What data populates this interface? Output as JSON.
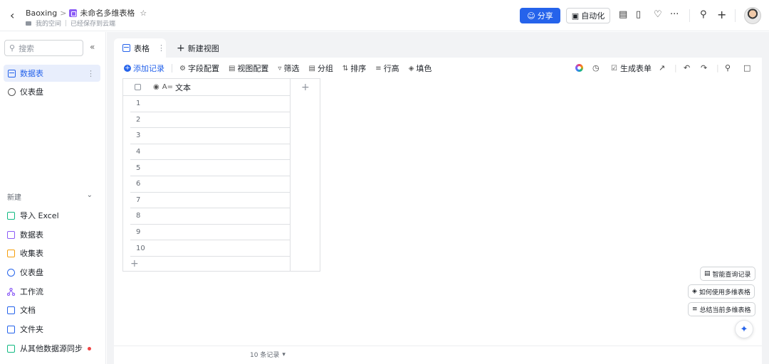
{
  "header": {
    "breadcrumb_root": "Baoxing",
    "breadcrumb_sep": ">",
    "doc_title": "未命名多维表格",
    "location": "我的空间",
    "save_status": "已经保存到云端",
    "share_label": "分享",
    "automation_label": "自动化"
  },
  "sidebar": {
    "search_placeholder": "搜索",
    "items": [
      {
        "label": "数据表",
        "active": true
      },
      {
        "label": "仪表盘",
        "active": false
      }
    ],
    "new_section": "新建",
    "new_items": [
      {
        "label": "导入 Excel",
        "icon": "excel-icon"
      },
      {
        "label": "数据表",
        "icon": "table-icon"
      },
      {
        "label": "收集表",
        "icon": "form-icon"
      },
      {
        "label": "仪表盘",
        "icon": "dashboard-icon"
      },
      {
        "label": "工作流",
        "icon": "workflow-icon"
      },
      {
        "label": "文档",
        "icon": "document-icon"
      },
      {
        "label": "文件夹",
        "icon": "folder-icon"
      },
      {
        "label": "从其他数据源同步",
        "icon": "sync-icon"
      }
    ]
  },
  "tabs": {
    "active_label": "表格",
    "new_view_label": "新建视图"
  },
  "toolbar": {
    "add_record": "添加记录",
    "field_config": "字段配置",
    "view_config": "视图配置",
    "filter": "筛选",
    "group": "分组",
    "sort": "排序",
    "row_height": "行高",
    "fill_color": "填色",
    "generate_form": "生成表单"
  },
  "grid": {
    "field_type": "A=",
    "field_name": "文本",
    "rows": [
      "1",
      "2",
      "3",
      "4",
      "5",
      "6",
      "7",
      "8",
      "9",
      "10"
    ]
  },
  "footer": {
    "record_count": "10 条记录"
  },
  "assistant": {
    "smart_query": "智能查询记录",
    "how_to_use": "如何使用多维表格",
    "summarize": "总结当前多维表格"
  },
  "colors": {
    "accent": "#2563eb",
    "sidebar_active_bg": "#e8eefc",
    "main_bg": "#f2f3f5"
  }
}
